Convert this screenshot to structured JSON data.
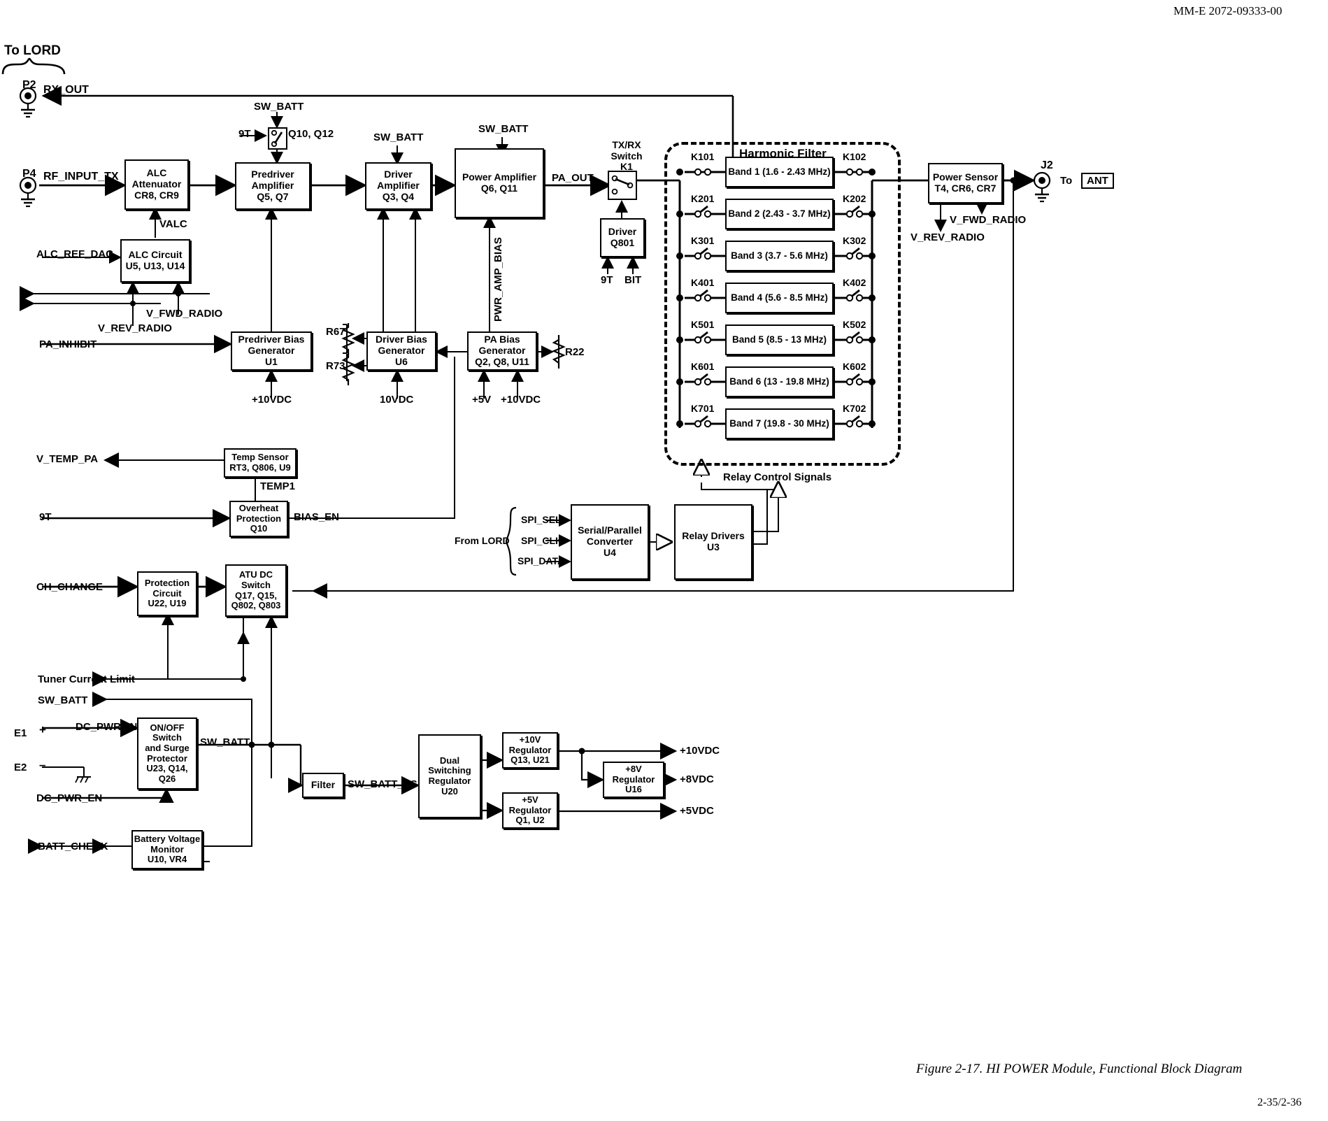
{
  "document": {
    "header_id": "MM-E 2072-09333-00",
    "figure_caption": "Figure 2-17. HI POWER Module, Functional Block Diagram",
    "page_number": "2-35/2-36"
  },
  "signals": {
    "to_lord": "To LORD",
    "p2": "P2",
    "rx_out": "RX_OUT",
    "p4": "P4",
    "rf_input_tx": "RF_INPUT_TX",
    "sw_batt": "SW_BATT",
    "sw_batt_2": "SW_BATT",
    "sw_batt_3": "SW_BATT",
    "sw_batt_4": "SW_BATT",
    "sw_batt_ps": "SW_BATT_PS",
    "nine_t_1": "9T",
    "nine_t_2": "9T",
    "nine_t_3": "9T",
    "bit": "BIT",
    "q10_q12": "Q10, Q12",
    "valc": "VALC",
    "alc_ref_dac": "ALC_REF_DAC",
    "v_fwd_radio": "V_FWD_RADIO",
    "v_rev_radio": "V_REV_RADIO",
    "v_fwd_radio_2": "V_FWD_RADIO",
    "v_rev_radio_2": "V_REV_RADIO",
    "pa_inhibit": "PA_INHIBIT",
    "pa_out": "PA_OUT",
    "pwr_amp_bias": "PWR_AMP_BIAS",
    "r67": "R67",
    "r73": "R73",
    "r22": "R22",
    "plus10vdc_1": "+10VDC",
    "vdc10": "10VDC",
    "plus5v": "+5V",
    "plus10vdc_2": "+10VDC",
    "v_temp_pa": "V_TEMP_PA",
    "temp1": "TEMP1",
    "bias_en": "BIAS_EN",
    "ch_change": "CH_CHANGE",
    "tuner_current_limit": "Tuner Current Limit",
    "sw_batt_out": "SW_BATT",
    "sw_batt_onoff": "SW_BATT",
    "dc_pwr_in": "DC_PWR_IN",
    "dc_pwr_en": "DC_PWR_EN",
    "batt_check": "BATT_CHECK",
    "e1": "E1",
    "e2": "E2",
    "plus_sign": "+",
    "minus_sign": "–",
    "from_lord": "From LORD",
    "spi_sel": "SPI_SEL",
    "spi_clk": "SPI_CLK",
    "spi_data": "SPI_DATA",
    "relay_control_signals": "Relay Control Signals",
    "j2": "J2",
    "to_ant_prefix": "To",
    "ant": "ANT",
    "out_10vdc": "+10VDC",
    "out_8vdc": "+8VDC",
    "out_5vdc": "+5VDC",
    "tx_rx_switch": "TX/RX\nSwitch\nK1"
  },
  "blocks": {
    "alc_attenuator": {
      "lines": [
        "ALC",
        "Attenuator",
        "CR8, CR9"
      ]
    },
    "alc_circuit": {
      "lines": [
        "ALC Circuit",
        "U5, U13, U14"
      ]
    },
    "predriver_amp": {
      "lines": [
        "Predriver",
        "Amplifier",
        "Q5, Q7"
      ]
    },
    "driver_amp": {
      "lines": [
        "Driver",
        "Amplifier",
        "Q3, Q4"
      ]
    },
    "power_amp": {
      "lines": [
        "Power Amplifier",
        "Q6, Q11"
      ]
    },
    "predriver_bias": {
      "lines": [
        "Predriver Bias",
        "Generator",
        "U1"
      ]
    },
    "driver_bias": {
      "lines": [
        "Driver Bias",
        "Generator",
        "U6"
      ]
    },
    "pa_bias": {
      "lines": [
        "PA Bias",
        "Generator",
        "Q2, Q8, U11"
      ]
    },
    "tx_rx_driver": {
      "lines": [
        "Driver",
        "Q801"
      ]
    },
    "power_sensor": {
      "lines": [
        "Power Sensor",
        "T4, CR6, CR7"
      ]
    },
    "temp_sensor": {
      "lines": [
        "Temp Sensor",
        "RT3, Q806, U9"
      ]
    },
    "overheat_protection": {
      "lines": [
        "Overheat",
        "Protection",
        "Q10"
      ]
    },
    "serial_parallel": {
      "lines": [
        "Serial/Parallel",
        "Converter",
        "U4"
      ]
    },
    "relay_drivers": {
      "lines": [
        "Relay Drivers",
        "U3"
      ]
    },
    "protection_circuit": {
      "lines": [
        "Protection",
        "Circuit",
        "U22, U19"
      ]
    },
    "atu_dc_switch": {
      "lines": [
        "ATU DC",
        "Switch",
        "Q17, Q15,",
        "Q802, Q803"
      ]
    },
    "onoff_switch": {
      "lines": [
        "ON/OFF",
        "Switch",
        "and Surge",
        "Protector",
        "U23, Q14,",
        "Q26"
      ]
    },
    "filter": {
      "lines": [
        "Filter"
      ]
    },
    "dual_switching_reg": {
      "lines": [
        "Dual",
        "Switching",
        "Regulator",
        "U20"
      ]
    },
    "reg_10v": {
      "lines": [
        "+10V",
        "Regulator",
        "Q13, U21"
      ]
    },
    "reg_8v": {
      "lines": [
        "+8V",
        "Regulator",
        "U16"
      ]
    },
    "reg_5v": {
      "lines": [
        "+5V",
        "Regulator",
        "Q1, U2"
      ]
    },
    "battery_monitor": {
      "lines": [
        "Battery Voltage",
        "Monitor",
        "U10, VR4"
      ]
    }
  },
  "harmonic_filter": {
    "title": "Harmonic Filter",
    "bands": [
      {
        "label": "Band 1 (1.6 - 2.43 MHz)",
        "relay_in": "K101",
        "relay_out": "K102",
        "closed": true
      },
      {
        "label": "Band 2 (2.43 - 3.7 MHz)",
        "relay_in": "K201",
        "relay_out": "K202",
        "closed": false
      },
      {
        "label": "Band 3 (3.7 - 5.6 MHz)",
        "relay_in": "K301",
        "relay_out": "K302",
        "closed": false
      },
      {
        "label": "Band 4 (5.6 - 8.5 MHz)",
        "relay_in": "K401",
        "relay_out": "K402",
        "closed": false
      },
      {
        "label": "Band 5 (8.5 - 13 MHz)",
        "relay_in": "K501",
        "relay_out": "K502",
        "closed": false
      },
      {
        "label": "Band 6 (13 - 19.8 MHz)",
        "relay_in": "K601",
        "relay_out": "K602",
        "closed": false
      },
      {
        "label": "Band 7 (19.8 - 30 MHz)",
        "relay_in": "K701",
        "relay_out": "K702",
        "closed": false
      }
    ]
  }
}
